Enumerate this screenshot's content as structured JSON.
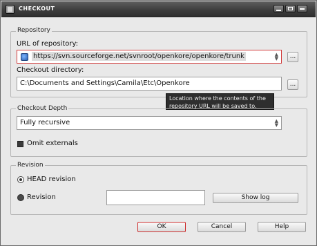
{
  "window": {
    "title": "CHECKOUT"
  },
  "repository": {
    "legend": "Repository",
    "url_label": "URL of repository:",
    "url_value": "https://svn.sourceforge.net/svnroot/openkore/openkore/trunk",
    "browse_label": "...",
    "dir_label": "Checkout directory:",
    "dir_value": "C:\\Documents and Settings\\Camila\\Etc\\Openkore",
    "dir_browse_label": "...",
    "tooltip_line1": "Location where the contents of the",
    "tooltip_line2": "repository URL will be saved to."
  },
  "depth": {
    "legend": "Checkout Depth",
    "selected": "Fully recursive",
    "omit_externals_label": "Omit externals",
    "omit_externals_checked": true
  },
  "revision": {
    "legend": "Revision",
    "head_label": "HEAD revision",
    "revision_label": "Revision",
    "revision_value": "",
    "selected": "HEAD revision",
    "show_log_label": "Show log"
  },
  "buttons": {
    "ok": "OK",
    "cancel": "Cancel",
    "help": "Help"
  },
  "colors": {
    "titlebar": "#3e3e3e",
    "focus_border": "#d23b3b",
    "tooltip_bg": "#2e2e2e"
  }
}
